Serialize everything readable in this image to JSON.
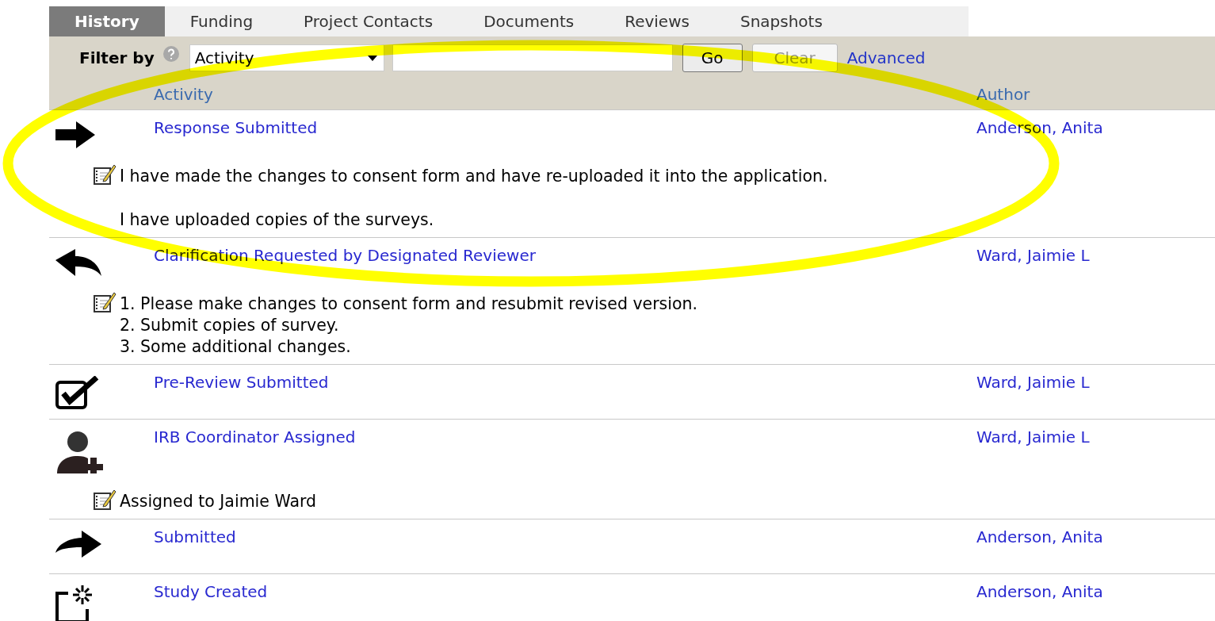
{
  "tabs": [
    {
      "label": "History",
      "selected": true
    },
    {
      "label": "Funding",
      "selected": false
    },
    {
      "label": "Project Contacts",
      "selected": false
    },
    {
      "label": "Documents",
      "selected": false
    },
    {
      "label": "Reviews",
      "selected": false
    },
    {
      "label": "Snapshots",
      "selected": false
    }
  ],
  "filter": {
    "label": "Filter by",
    "select_value": "Activity",
    "go": "Go",
    "clear": "Clear",
    "advanced": "Advanced"
  },
  "table": {
    "columns": [
      "Activity",
      "Author"
    ],
    "rows": [
      {
        "kind": "response",
        "activity": "Response Submitted",
        "author": "Anderson, Anita",
        "note": [
          [
            "I have made the changes to consent form and have re-uploaded it into the application."
          ],
          [
            "I have uploaded copies of the surveys."
          ]
        ]
      },
      {
        "kind": "request",
        "activity": "Clarification Requested by Designated Reviewer",
        "author": "Ward, Jaimie L",
        "note": [
          [
            "1. Please make changes to consent form and resubmit revised version.",
            "2. Submit copies of survey.",
            "3. Some additional changes."
          ]
        ]
      },
      {
        "kind": "review",
        "activity": "Pre-Review Submitted",
        "author": "Ward, Jaimie L"
      },
      {
        "kind": "assignment",
        "activity": "IRB Coordinator Assigned",
        "author": "Ward, Jaimie L",
        "note": [
          [
            "Assigned to Jaimie Ward"
          ]
        ]
      },
      {
        "kind": "submission",
        "activity": "Submitted",
        "author": "Anderson, Anita"
      },
      {
        "kind": "creation",
        "activity": "Study Created",
        "author": "Anderson, Anita"
      }
    ]
  },
  "annotation": {
    "kind": "ellipse"
  }
}
